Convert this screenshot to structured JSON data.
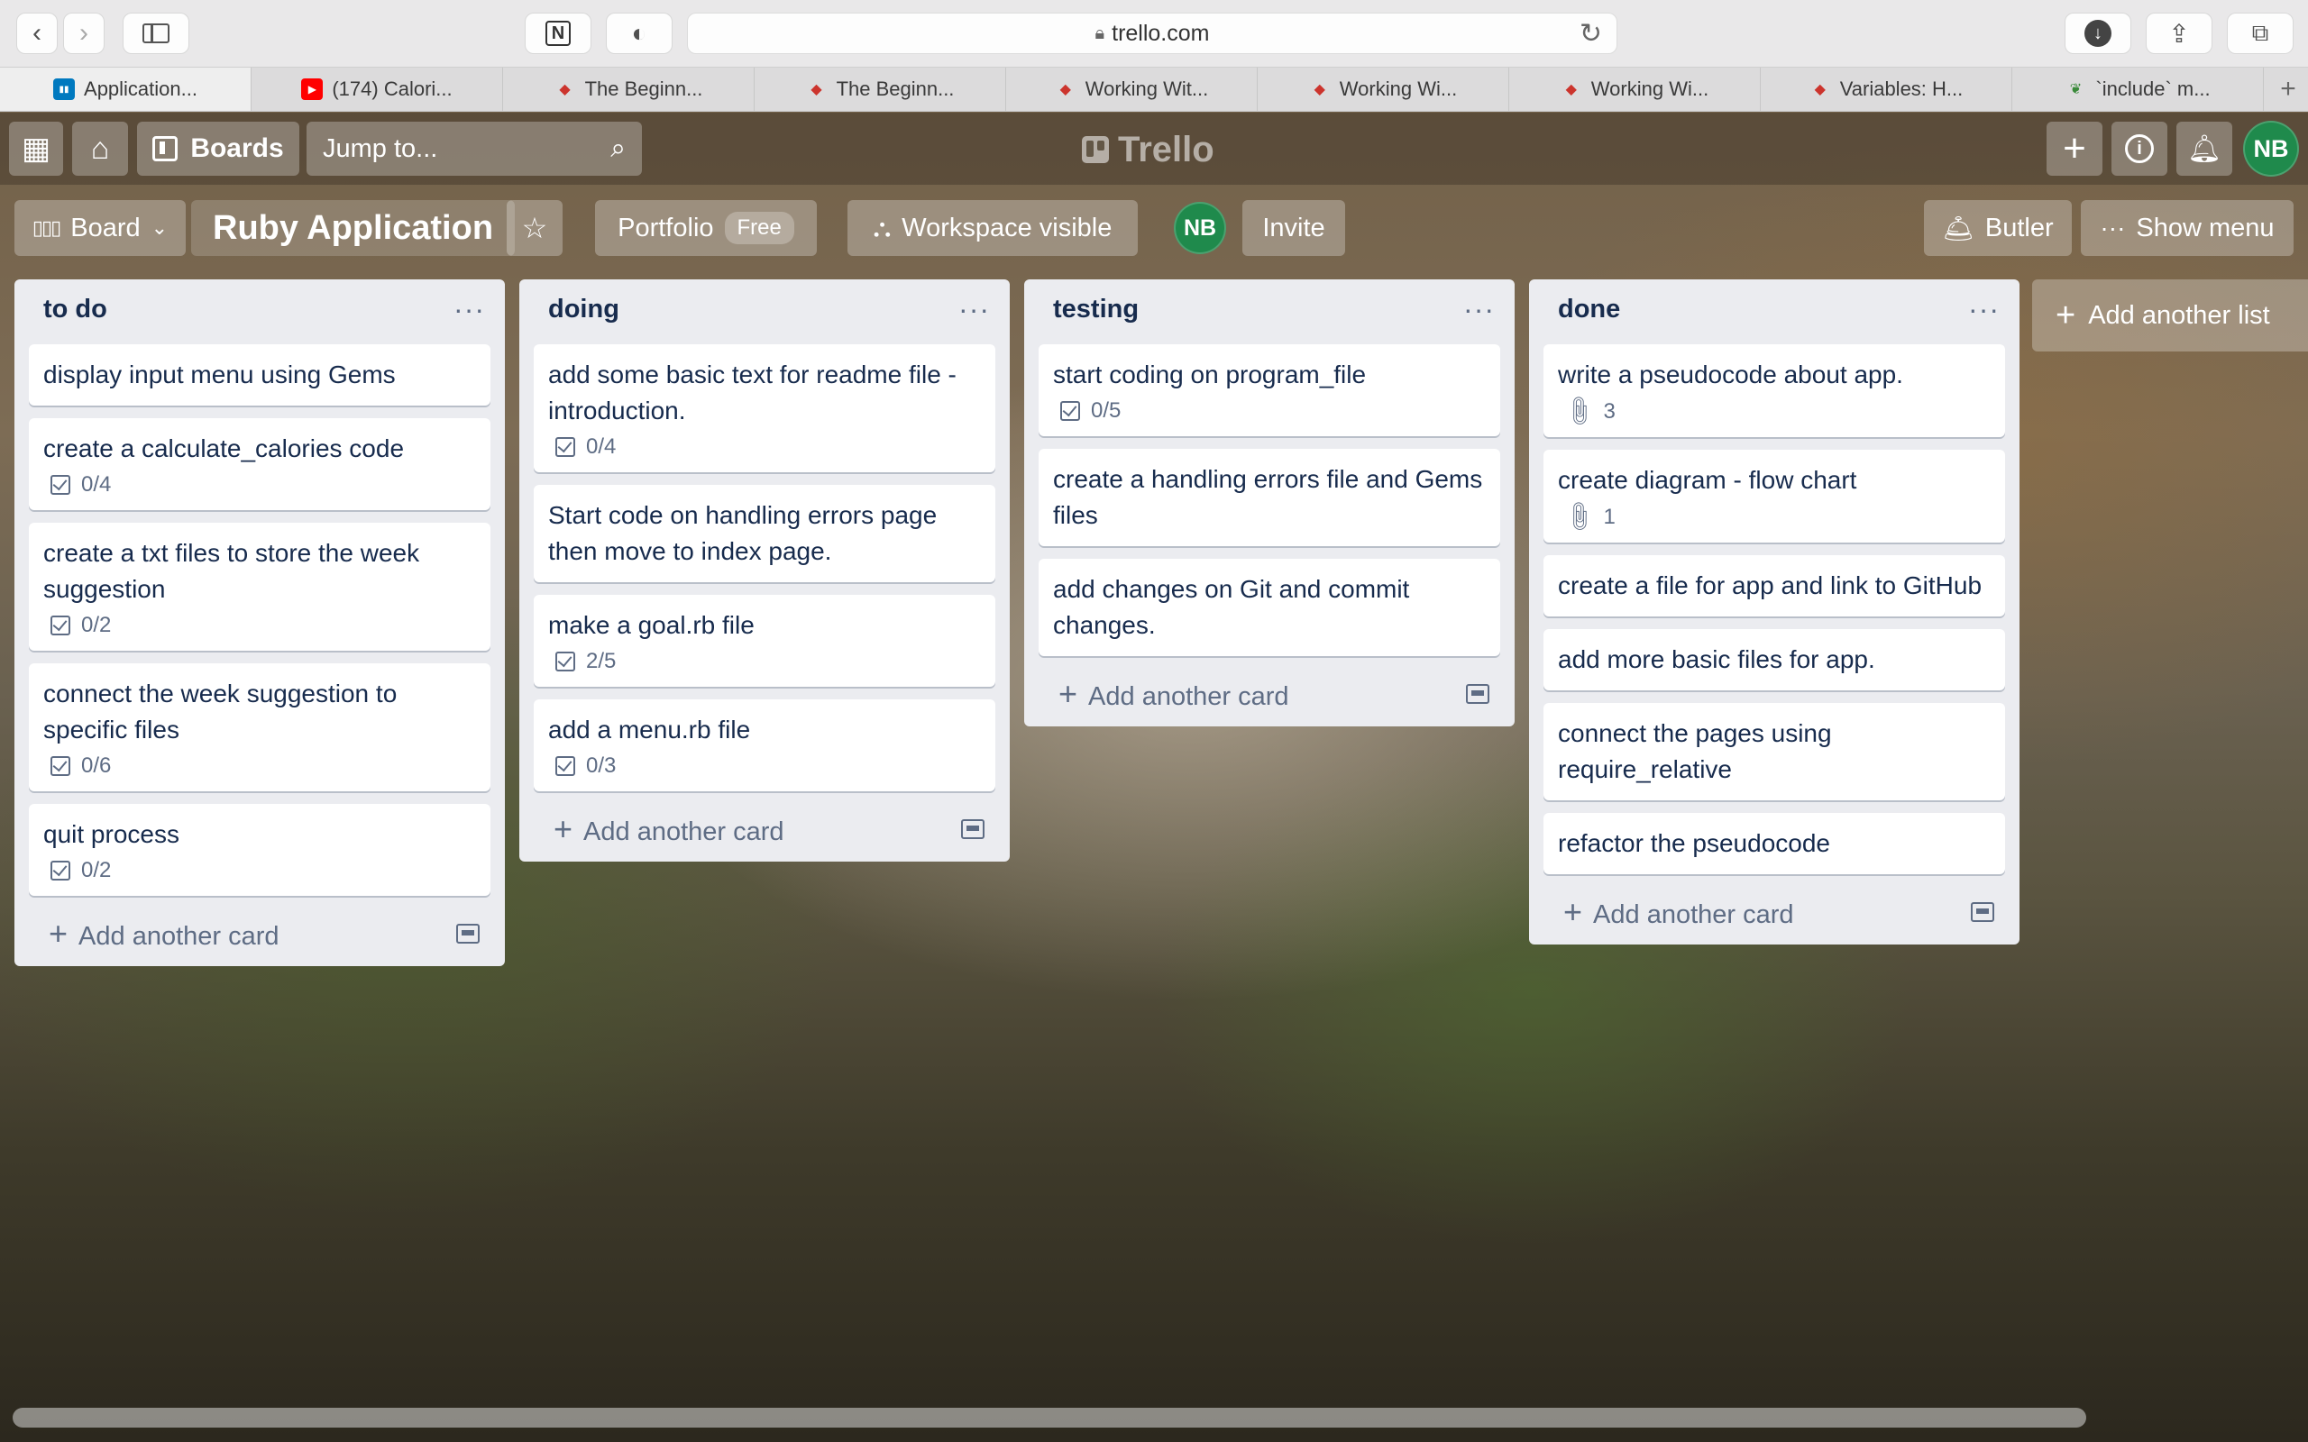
{
  "browser": {
    "url": "trello.com",
    "tabs": [
      {
        "label": "Application...",
        "icon": "trello-icon",
        "color": "#0079bf"
      },
      {
        "label": "(174) Calori...",
        "icon": "youtube-icon",
        "color": "#ff0000"
      },
      {
        "label": "The Beginn...",
        "icon": "ruby-icon",
        "color": "#cc342d"
      },
      {
        "label": "The Beginn...",
        "icon": "ruby-icon",
        "color": "#cc342d"
      },
      {
        "label": "Working Wit...",
        "icon": "ruby-icon",
        "color": "#cc342d"
      },
      {
        "label": "Working Wi...",
        "icon": "ruby-icon",
        "color": "#cc342d"
      },
      {
        "label": "Working Wi...",
        "icon": "ruby-icon",
        "color": "#cc342d"
      },
      {
        "label": "Variables: H...",
        "icon": "ruby-icon",
        "color": "#cc342d"
      },
      {
        "label": "`include` m...",
        "icon": "leaf-icon",
        "color": "#3a8a3a"
      }
    ]
  },
  "header": {
    "boards_label": "Boards",
    "search_placeholder": "Jump to...",
    "logo_text": "Trello",
    "avatar_initials": "NB"
  },
  "board": {
    "view_label": "Board",
    "title": "Ruby Application",
    "workspace_label": "Portfolio",
    "plan_badge": "Free",
    "visibility_label": "Workspace visible",
    "member_initials": "NB",
    "invite_label": "Invite",
    "butler_label": "Butler",
    "show_menu_label": "Show menu",
    "add_list_label": "Add another list",
    "add_card_label": "Add another card"
  },
  "lists": [
    {
      "title": "to do",
      "cards": [
        {
          "title": "display input menu using Gems"
        },
        {
          "title": "create a calculate_calories code",
          "checklist": "0/4"
        },
        {
          "title": "create a txt files to store the week suggestion",
          "checklist": "0/2"
        },
        {
          "title": "connect the week suggestion to specific files",
          "checklist": "0/6"
        },
        {
          "title": "quit process",
          "checklist": "0/2"
        }
      ]
    },
    {
      "title": "doing",
      "cards": [
        {
          "title": "add some basic text for readme file - introduction.",
          "checklist": "0/4"
        },
        {
          "title": "Start code on handling errors page then move to index page."
        },
        {
          "title": "make a goal.rb file",
          "checklist": "2/5"
        },
        {
          "title": "add a menu.rb file",
          "checklist": "0/3"
        }
      ]
    },
    {
      "title": "testing",
      "cards": [
        {
          "title": "start coding on program_file",
          "checklist": "0/5"
        },
        {
          "title": "create a handling errors file and Gems files"
        },
        {
          "title": "add changes on Git and commit changes."
        }
      ]
    },
    {
      "title": "done",
      "cards": [
        {
          "title": "write a pseudocode about app.",
          "attachments": "3"
        },
        {
          "title": "create diagram - flow chart",
          "attachments": "1"
        },
        {
          "title": "create a file for app and link to GitHub"
        },
        {
          "title": "add more basic files for app."
        },
        {
          "title": "connect the pages using require_relative"
        },
        {
          "title": "refactor the pseudocode"
        }
      ]
    }
  ]
}
